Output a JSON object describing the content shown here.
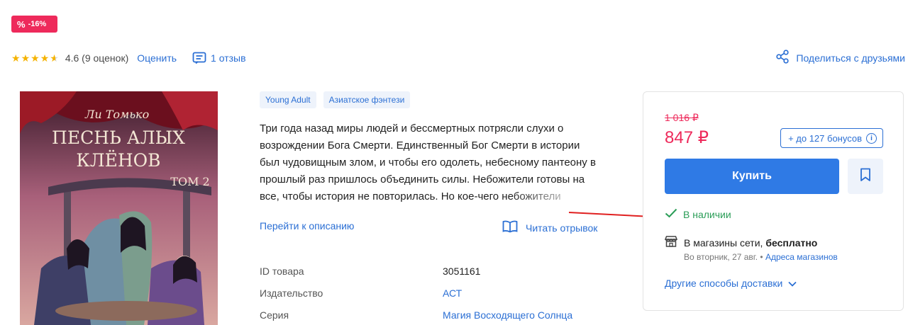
{
  "badge": {
    "label": "-16%"
  },
  "rating": {
    "value_text": "4.6 (9 оценок)",
    "rate_label": "Оценить",
    "reviews_label": "1 отзыв"
  },
  "share": {
    "label": "Поделиться с друзьями"
  },
  "cover": {
    "author": "Ли Томько",
    "title_line1": "ПЕСНЬ АЛЫХ",
    "title_line2": "КЛЁНОВ",
    "volume": "ТОМ 2"
  },
  "tags": [
    "Young Adult",
    "Азиатское фэнтези"
  ],
  "description": "Три года назад миры людей и бессмертных потрясли слухи о возрождении Бога Смерти. Единственный Бог Смерти в истории был чудовищным злом, и чтобы его одолеть, небесному пантеону в прошлый раз пришлось объединить силы. Небожители готовы на все, чтобы история не повторилась. Но кое-чего небожители",
  "links": {
    "goto_description": "Перейти к описанию",
    "read_excerpt": "Читать отрывок"
  },
  "specs": [
    {
      "label": "ID товара",
      "value": "3051161"
    },
    {
      "label": "Издательство",
      "value": "АСТ"
    },
    {
      "label": "Серия",
      "value": "Магия Восходящего Солнца"
    }
  ],
  "price": {
    "old": "1 016 ₽",
    "current": "847 ₽",
    "bonus": "+ до 127 бонусов",
    "buy_label": "Купить",
    "availability": "В наличии",
    "store_delivery_prefix": "В магазины сети,",
    "store_delivery_bold": "бесплатно",
    "store_date": "Во вторник, 27 авг. •",
    "store_addresses": "Адреса магазинов",
    "other_delivery": "Другие способы доставки"
  },
  "colors": {
    "accent": "#2b6fd4",
    "sale": "#ee2a5b",
    "success": "#2a9d57",
    "button": "#2f7ae5"
  }
}
